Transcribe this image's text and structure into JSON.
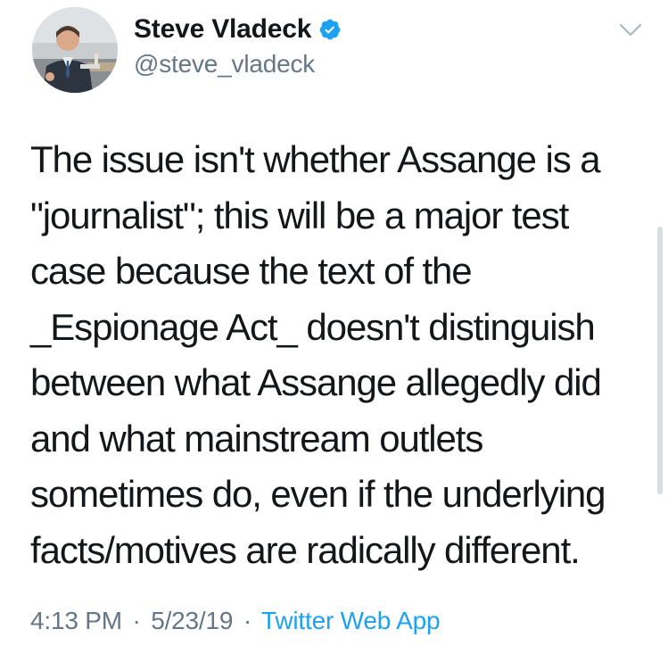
{
  "author": {
    "display_name": "Steve Vladeck",
    "handle": "@steve_vladeck",
    "verified": true
  },
  "tweet": {
    "text_lines": [
      "The issue isn't whether Assange is a",
      "\"journalist\"; this will be a major test",
      "case because the text of the",
      "_Espionage Act_ doesn't distinguish",
      "between what Assange allegedly did",
      "and what mainstream outlets",
      "sometimes do, even if the underlying",
      "facts/motives are radically different."
    ],
    "time": "4:13 PM",
    "date": "5/23/19",
    "separator": "·",
    "source": "Twitter Web App"
  },
  "icons": {
    "verified": "verified-badge-icon",
    "menu": "chevron-down-icon"
  },
  "colors": {
    "text": "#14171a",
    "muted": "#657786",
    "link": "#1da1f2",
    "verified": "#1da1f2"
  }
}
